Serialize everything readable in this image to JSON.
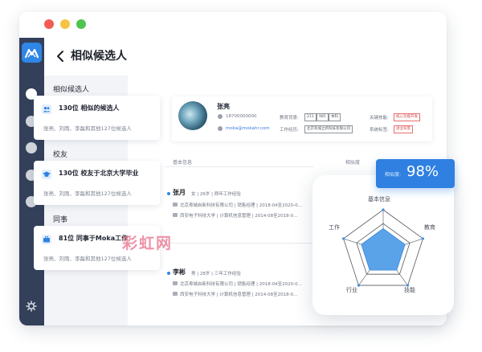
{
  "page_title": "相似候选人",
  "sections": [
    {
      "label": "相似候选人",
      "card_title": "130位 相似的候选人",
      "card_sub": "张亮、刘雨、李磊和其他127位候选人"
    },
    {
      "label": "校友",
      "card_title": "130位 校友于北京大学毕业",
      "card_sub": "张亮、刘雨、李磊和其他127位候选人"
    },
    {
      "label": "同事",
      "card_title": "81位 同事于Moka工作",
      "card_sub": "张亮、刘雨、李磊和其他127位候选人"
    }
  ],
  "profile": {
    "name": "张亮",
    "phone": "18700000000",
    "email": "moka@mokahr.com",
    "edu_label": "教育背景:",
    "edu_tags": [
      "211",
      "985",
      "本科"
    ],
    "work_label": "工作经历:",
    "work_tag": "北京有城立新科技有限公司",
    "skill_label": "关键技能:",
    "skill_tag": "核心功能开发",
    "sys_label": "系统标签:",
    "sys_tag": "进业背景"
  },
  "columns": {
    "basic": "基本信息",
    "similarity": "相似度"
  },
  "candidates": [
    {
      "name": "张月",
      "meta": "女 | 26岁 | 两年工作经验",
      "line1": "北京寿城启新科技有限公司 | 销售经理 | 2018-04至2020-0…",
      "line2": "西安电子科技大学 | 计算机信息管理 | 2014-08至2018-0…"
    },
    {
      "name": "李彬",
      "meta": "男 | 28岁 | 三年工作经验",
      "line1": "北京寿城启新科技有限公司 | 销售经理 | 2018-04至2020-0…",
      "line2": "西安电子科技大学 | 计算机信息管理 | 2014-08至2018-0…"
    }
  ],
  "similarity": {
    "label": "相似度:",
    "value": "98%"
  },
  "radar": {
    "axes": [
      "基本信息",
      "教育",
      "技能",
      "行业",
      "工作"
    ],
    "values": [
      0.55,
      0.55,
      0.55,
      0.55,
      0.55
    ],
    "fill_color": "#5aa3e8"
  },
  "watermark": "彩虹网",
  "icons": {
    "logo": "moka-logo-icon",
    "back": "back-arrow-icon",
    "settings": "gear-icon"
  },
  "colors": {
    "accent": "#2f80e0",
    "sidebar": "#34405a"
  }
}
